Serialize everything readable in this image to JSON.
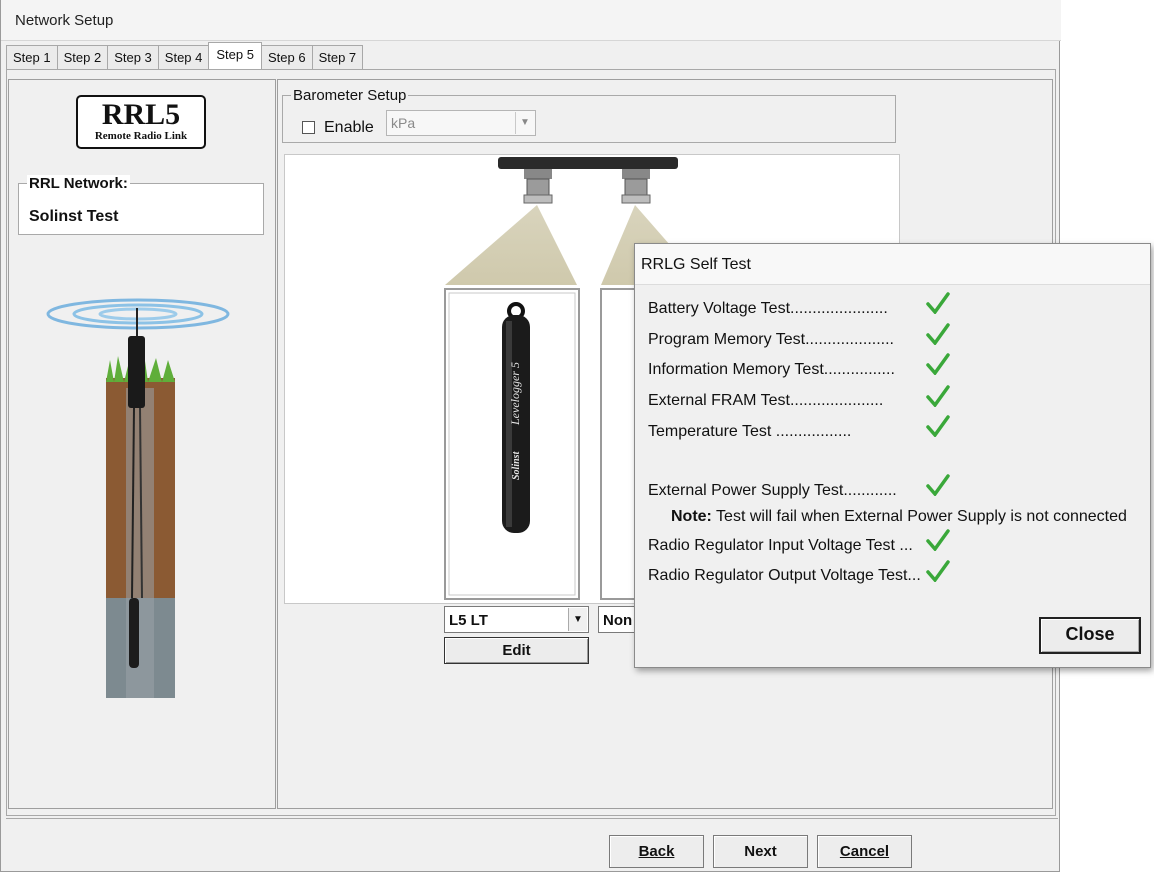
{
  "window": {
    "title": "Network Setup"
  },
  "tabs": [
    "Step 1",
    "Step 2",
    "Step 3",
    "Step 4",
    "Step 5",
    "Step 6",
    "Step 7"
  ],
  "active_tab": "Step 5",
  "left": {
    "logo_main": "RRL5",
    "logo_sub": "Remote Radio Link",
    "network_label": "RRL Network:",
    "network_name": "Solinst Test"
  },
  "barometer": {
    "title": "Barometer Setup",
    "enable_label": "Enable",
    "enabled": false,
    "unit": "kPa"
  },
  "logger": {
    "brand": "Solinst",
    "model_text": "Levelogger 5",
    "slot1_value": "L5 LT",
    "slot2_value": "Non",
    "edit_label": "Edit"
  },
  "nav": {
    "back_label": "Back",
    "next_label": "Next",
    "cancel_label": "Cancel"
  },
  "self_test": {
    "title": "RRLG Self Test",
    "tests": [
      {
        "label": "Battery Voltage Test......................",
        "passed": true
      },
      {
        "label": "Program Memory Test....................",
        "passed": true
      },
      {
        "label": "Information Memory Test................",
        "passed": true
      },
      {
        "label": "External FRAM Test.....................",
        "passed": true
      },
      {
        "label": "Temperature Test .................",
        "passed": true
      },
      {
        "label": "External Power Supply Test............",
        "passed": true
      },
      {
        "label": "Radio Regulator Input Voltage Test ...",
        "passed": true
      },
      {
        "label": "Radio Regulator Output Voltage Test...",
        "passed": true
      }
    ],
    "note_prefix": "Note:",
    "note_text": " Test will fail when External Power Supply is not connected",
    "close_label": "Close"
  },
  "colors": {
    "check_green": "#3aa83a",
    "earth": "#8b5a33",
    "grass": "#5fae3a"
  }
}
